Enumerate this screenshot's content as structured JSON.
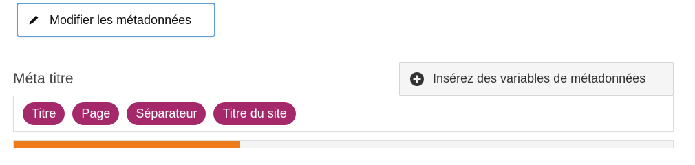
{
  "edit_button": {
    "label": "Modifier les métadonnées",
    "icon": "pencil-icon"
  },
  "meta_title": {
    "label": "Méta titre",
    "insert_button": {
      "label": "Insérez des variables de métadonnées",
      "icon": "plus-circle-icon"
    },
    "variables": [
      {
        "label": "Titre"
      },
      {
        "label": "Page"
      },
      {
        "label": "Séparateur"
      },
      {
        "label": "Titre du site"
      }
    ],
    "progress": {
      "fraction": 0.343,
      "color": "#ee7c1b"
    }
  },
  "colors": {
    "pill": "#a4286a",
    "focus_border": "#5b9dd9"
  }
}
